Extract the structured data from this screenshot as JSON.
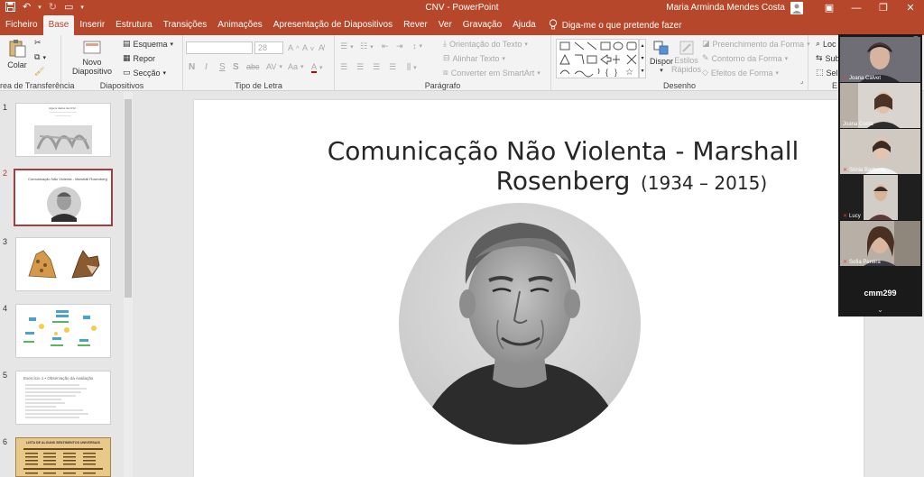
{
  "window": {
    "doc_title": "CNV  -  PowerPoint",
    "user_name": "Maria Arminda Mendes Costa"
  },
  "tabs": [
    "Ficheiro",
    "Base",
    "Inserir",
    "Estrutura",
    "Transições",
    "Animações",
    "Apresentação de Diapositivos",
    "Rever",
    "Ver",
    "Gravação",
    "Ajuda"
  ],
  "active_tab": "Base",
  "tell_me": "Diga-me o que pretende fazer",
  "ribbon": {
    "clipboard": {
      "paste": "Colar",
      "label": "rea de Transferência"
    },
    "slides": {
      "new_slide_1": "Novo",
      "new_slide_2": "Diapositivo",
      "layout": "Esquema",
      "reset": "Repor",
      "section": "Secção",
      "label": "Diapositivos"
    },
    "font": {
      "size": "28",
      "bold": "N",
      "italic": "I",
      "underline": "S",
      "strike": "S",
      "shadow": "abc",
      "spacing": "AV",
      "case": "Aa",
      "grow": "A",
      "shrink": "A",
      "label": "Tipo de Letra"
    },
    "paragraph": {
      "direction": "Orientação do Texto",
      "align": "Alinhar Texto",
      "smartart": "Converter em SmartArt",
      "label": "Parágrafo"
    },
    "drawing": {
      "arrange": "Dispor",
      "styles_1": "Estilos",
      "styles_2": "Rápidos",
      "fill": "Preenchimento da Forma",
      "outline": "Contorno da Forma",
      "effects": "Efeitos de Forma",
      "label": "Desenho"
    },
    "editing": {
      "find": "Loc",
      "replace": "Sub",
      "select": "Sel",
      "label": "E"
    }
  },
  "thumbnails": [
    {
      "num": "1",
      "text": "Alguns dados da CNV..."
    },
    {
      "num": "2",
      "text": "Comunicação Não Violenta - Marshall Rosenberg"
    },
    {
      "num": "3",
      "text": ""
    },
    {
      "num": "4",
      "text": ""
    },
    {
      "num": "5",
      "text": "Exercício 1 • Observação da Avaliação"
    },
    {
      "num": "6",
      "text": "LISTA DE ALGUNS SENTIMENTOS UNIVERSAIS"
    }
  ],
  "slide": {
    "title": "Comunicação Não Violenta - Marshall Rosenberg",
    "subtitle": "(1934 – 2015)"
  },
  "video": {
    "participants": [
      {
        "name": "Joana Calvet",
        "bg": "#6f6e77"
      },
      {
        "name": "Joana Costa",
        "bg": "#d9d4cf"
      },
      {
        "name": "Sónia Barbosa",
        "bg": "#cfc9c2"
      },
      {
        "name": "Lucy",
        "bg": "#3c332d"
      },
      {
        "name": "Sofia Pereira",
        "bg": "#b8b0a6"
      }
    ],
    "host": "cmm299"
  },
  "colors": {
    "accent": "#b7472a",
    "selected_border": "#a63d40"
  }
}
